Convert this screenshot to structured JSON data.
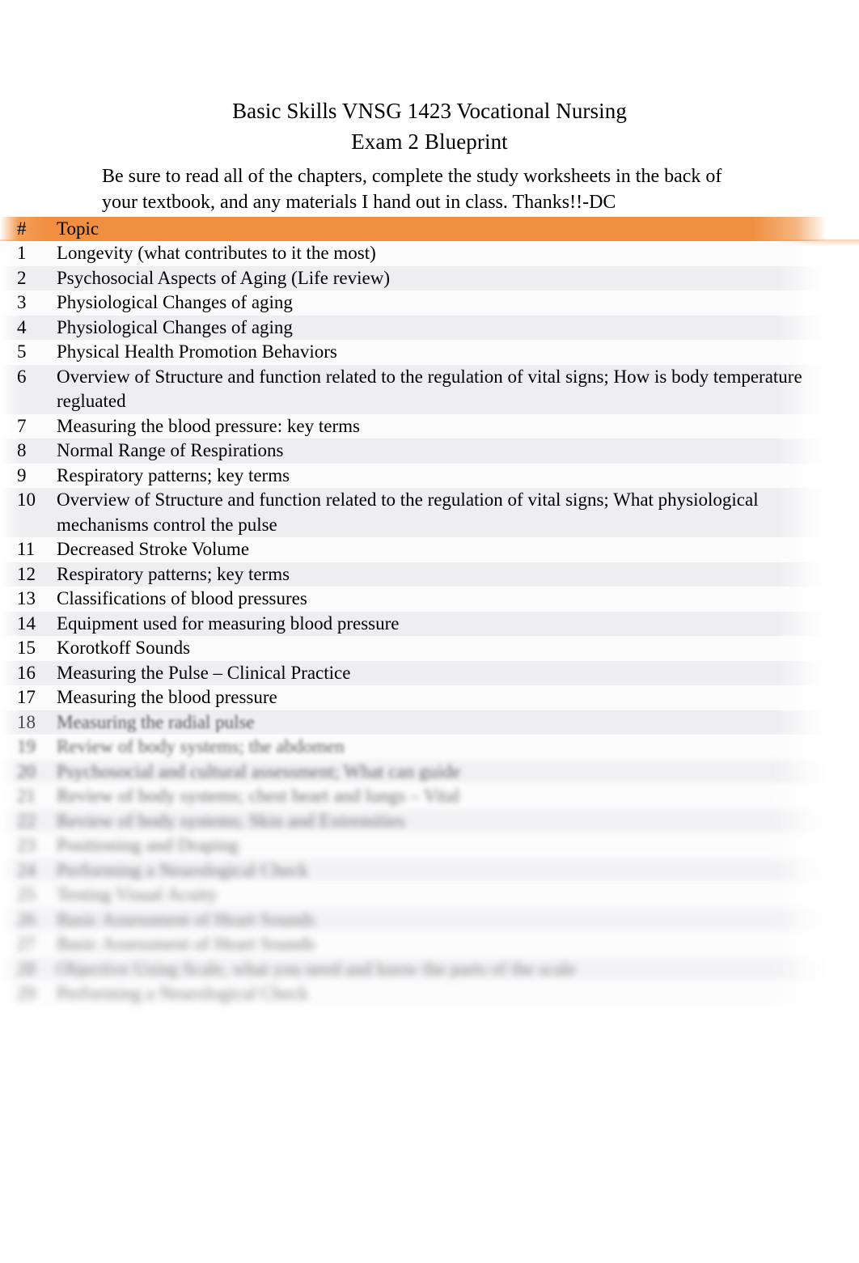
{
  "document": {
    "title_line_1": "Basic Skills VNSG 1423 Vocational Nursing",
    "title_line_2": "Exam 2 Blueprint",
    "intro_line_1": "Be sure to read all of the chapters, complete the study worksheets in the back of",
    "intro_line_2": "your textbook, and any materials I hand out in class. Thanks!!-DC"
  },
  "colors": {
    "header_band": "#ef8f3f",
    "row_stripe": "#eeeef1",
    "row_alt": "#fbfbfc",
    "text": "#000000"
  },
  "table": {
    "headers": {
      "number": "#",
      "topic": "Topic"
    },
    "rows": [
      {
        "num": "1",
        "topic": "Longevity (what contributes to it the most)"
      },
      {
        "num": "2",
        "topic": "Psychosocial Aspects of Aging (Life review)"
      },
      {
        "num": "3",
        "topic": "Physiological Changes of aging"
      },
      {
        "num": "4",
        "topic": "Physiological Changes of aging"
      },
      {
        "num": "5",
        "topic": "Physical Health Promotion Behaviors"
      },
      {
        "num": "6",
        "topic": "Overview of Structure and function related to the regulation of vital signs; How is body temperature regluated"
      },
      {
        "num": "7",
        "topic": "Measuring the blood pressure: key terms"
      },
      {
        "num": "8",
        "topic": "Normal Range of Respirations"
      },
      {
        "num": "9",
        "topic": "Respiratory patterns; key terms"
      },
      {
        "num": "10",
        "topic": "Overview of Structure and function related to the regulation of vital signs; What physiological mechanisms control the pulse"
      },
      {
        "num": "11",
        "topic": "Decreased Stroke Volume"
      },
      {
        "num": "12",
        "topic": "Respiratory patterns; key terms"
      },
      {
        "num": "13",
        "topic": "Classifications of blood pressures"
      },
      {
        "num": "14",
        "topic": "Equipment used for measuring blood pressure"
      },
      {
        "num": "15",
        "topic": "Korotkoff Sounds"
      },
      {
        "num": "16",
        "topic": "Measuring the Pulse – Clinical Practice"
      },
      {
        "num": "17",
        "topic": "Measuring the blood pressure"
      },
      {
        "num": "18",
        "topic": "Measuring the radial pulse"
      },
      {
        "num": "19",
        "topic": "Review of body systems; the abdomen"
      },
      {
        "num": "20",
        "topic": "Psychosocial and cultural assessment; What can guide"
      },
      {
        "num": "21",
        "topic": "Review of body systems; chest heart and lungs – Vital"
      },
      {
        "num": "22",
        "topic": "Review of body systems; Skin and Extremities"
      },
      {
        "num": "23",
        "topic": "Positioning and Draping"
      },
      {
        "num": "24",
        "topic": "Performing a Neurological Check"
      },
      {
        "num": "25",
        "topic": "Testing Visual Acuity"
      },
      {
        "num": "26",
        "topic": "Basic Assessment of Heart Sounds"
      },
      {
        "num": "27",
        "topic": "Basic Assessment of Heart Sounds"
      },
      {
        "num": "28",
        "topic": "Objective Using Scale, what you need and know the parts of the scale"
      },
      {
        "num": "29",
        "topic": "Performing a Neurological Check"
      }
    ]
  }
}
